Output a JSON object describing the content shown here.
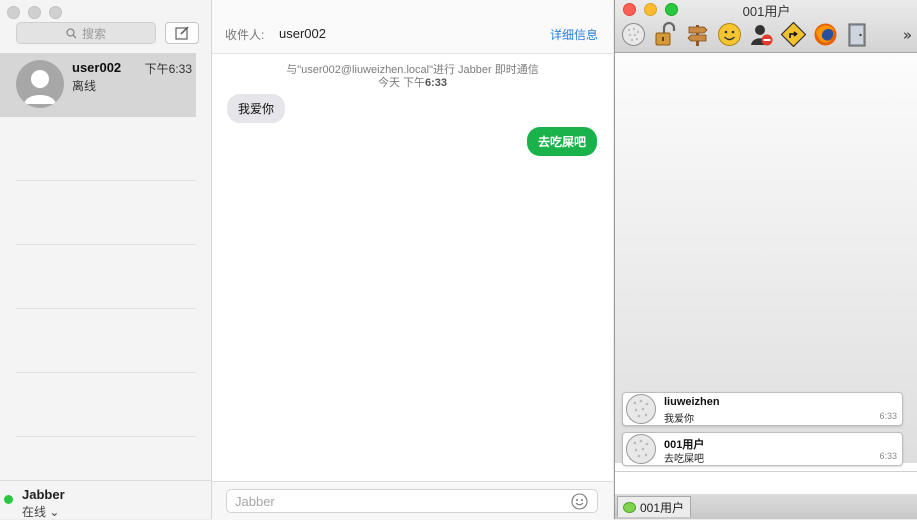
{
  "messages_app": {
    "sidebar": {
      "search_placeholder": "搜索",
      "compose_icon": "compose-icon",
      "conversations": [
        {
          "name": "user002",
          "status": "离线",
          "time": "下午6:33",
          "selected": true
        }
      ],
      "footer": {
        "account": "Jabber",
        "status": "在线 ⌄"
      }
    },
    "chat": {
      "to_label": "收件人:",
      "to_value": "user002",
      "details_link": "详细信息",
      "meta_line1": "与\"user002@liuweizhen.local\"进行 Jabber 即时通信",
      "meta_day": "今天 下午",
      "meta_time": "6:33",
      "incoming_message": "我爱你",
      "outgoing_message": "去吃屎吧",
      "input_placeholder": "Jabber"
    }
  },
  "jabber_app": {
    "title": "001用户",
    "toolbar_icons": [
      "golf-ball-icon",
      "lock-icon",
      "signpost-icon",
      "smiley-icon",
      "user-block-icon",
      "direction-sign-icon",
      "firefox-icon",
      "door-icon"
    ],
    "overflow": "»",
    "messages": [
      {
        "name": "liuweizhen",
        "text": "我爱你",
        "time": "6:33"
      },
      {
        "name": "001用户",
        "text": "去吃屎吧",
        "time": "6:33"
      }
    ],
    "tab": {
      "label": "001用户"
    }
  },
  "colors": {
    "outgoing_bubble": "#1ab24b",
    "incoming_bubble": "#e5e5ea",
    "link": "#2a7ee0",
    "online": "#27c93f"
  }
}
